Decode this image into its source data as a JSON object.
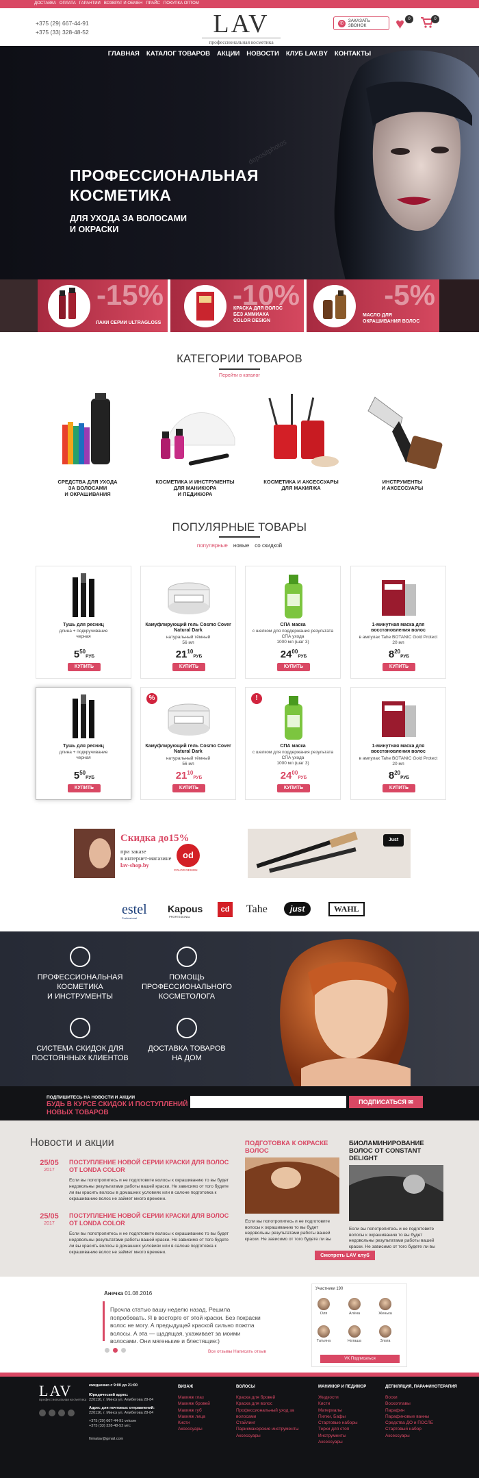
{
  "topbar": {
    "links": [
      "Доставка",
      "Оплата",
      "Гарантии",
      "Возврат и обмен",
      "Прайс",
      "Покупка оптом"
    ]
  },
  "header": {
    "phones": [
      "+375 (29) 667-44-91",
      "+375 (33) 328-48-52"
    ],
    "logo": "LAV",
    "logo_sub": "профессиональная косметика",
    "call_button": "Заказать звонок",
    "favorites_count": "0",
    "cart_count": "0"
  },
  "nav": [
    "Главная",
    "Каталог товаров",
    "Акции",
    "Новости",
    "Клуб LAV.BY",
    "Контакты"
  ],
  "hero": {
    "title_line1": "Профессиональная",
    "title_line2": "косметика",
    "subtitle_line1": "для ухода за волосами",
    "subtitle_line2": "и окраски",
    "watermark": "depositphotos"
  },
  "promo_banners": [
    {
      "discount": "-15%",
      "label": "Лаки серии ULTRAGLOSS",
      "color": "#c8374f"
    },
    {
      "discount": "-10%",
      "label_lines": [
        "Краска для волос",
        "без аммиака",
        "COLOR DESIGN"
      ],
      "color": "#c8374f"
    },
    {
      "discount": "-5%",
      "label_lines": [
        "Масло для",
        "окрашивания волос"
      ],
      "color": "#c8374f"
    }
  ],
  "categories": {
    "title": "Категории товаров",
    "catalog_link": "Перейти в каталог",
    "items": [
      {
        "lines": [
          "Средства для ухода",
          "за волосами",
          "и окрашивания"
        ]
      },
      {
        "lines": [
          "Косметика и инструменты",
          "для маникюра",
          "и педикюра"
        ]
      },
      {
        "lines": [
          "Косметика и аксессуары",
          "для макияжа"
        ]
      },
      {
        "lines": [
          "Инструменты",
          "и аксессуары"
        ]
      }
    ]
  },
  "popular": {
    "title": "Популярные товары",
    "tabs": [
      "популярные",
      "новые",
      "со скидкой"
    ],
    "buy_label": "купить",
    "currency": "руб",
    "products": [
      {
        "name": "Тушь для ресниц",
        "desc": [
          "длина + подкручивание",
          "черная"
        ],
        "rub": "5",
        "kop": "50",
        "mark": ""
      },
      {
        "name": "Камуфлирующий гель Cosmo Cover Natural Dark",
        "desc": [
          "натуральный тёмный",
          "56 мл"
        ],
        "rub": "21",
        "kop": "10",
        "mark": ""
      },
      {
        "name": "СПА маска",
        "desc": [
          "с шелком для поддержания результата",
          "СПА ухода",
          "1000 мл (шаг 3)"
        ],
        "rub": "24",
        "kop": "00",
        "mark": ""
      },
      {
        "name": "1-минутная маска для восстановления волос",
        "desc": [
          "в ампулах Tahe BOTANIC Gold Protect",
          "20 мл"
        ],
        "rub": "8",
        "kop": "20",
        "mark": ""
      },
      {
        "name": "Тушь для ресниц",
        "desc": [
          "длина + подкручивание",
          "черная"
        ],
        "rub": "5",
        "kop": "50",
        "mark": ""
      },
      {
        "name": "Камуфлирующий гель Cosmo Cover Natural Dark",
        "desc": [
          "натуральный тёмный",
          "56 мл"
        ],
        "rub": "21",
        "kop": "10",
        "mark": "%"
      },
      {
        "name": "СПА маска",
        "desc": [
          "с шелком для поддержания результата",
          "СПА ухода",
          "1000 мл (шаг 3)"
        ],
        "rub": "24",
        "kop": "00",
        "mark": "!"
      },
      {
        "name": "1-минутная маска для восстановления волос",
        "desc": [
          "в ампулах Tahe BOTANIC Gold Protect",
          "20 мл"
        ],
        "rub": "8",
        "kop": "20",
        "mark": ""
      }
    ]
  },
  "ad_banner": {
    "title": "Скидка до15%",
    "line1": "при заказе",
    "line2": "в интернет-магазине",
    "site": "lav-shop.by",
    "brand": "od",
    "brand_sub": "COLOR DESIGN",
    "right_brand": "Just"
  },
  "brands": [
    "estel",
    "Kapous",
    "cd",
    "Tahe",
    "just",
    "WAHL"
  ],
  "brands_sub": {
    "estel": "Professional",
    "Kapous": "PROFESSIONAL"
  },
  "features": [
    {
      "lines": [
        "Профессиональная",
        "косметика",
        "и инструменты"
      ]
    },
    {
      "lines": [
        "Помощь",
        "профессионального",
        "косметолога"
      ]
    },
    {
      "lines": [
        "Система скидок для",
        "постоянных клиентов"
      ]
    },
    {
      "lines": [
        "Доставка товаров",
        "на дом"
      ]
    }
  ],
  "subscribe": {
    "small": "Подпишитесь на новости и акции",
    "big_line1": "Будь в курсе скидок и поступлений",
    "big_line2": "новых товаров",
    "button": "Подписаться"
  },
  "news": {
    "title": "Новости и акции",
    "items": [
      {
        "day": "25/05",
        "year": "2017",
        "head": "Поступление новой серии краски для волос от LONDA COLOR",
        "text": "Если вы попотропитесь и не подготовите волосы к окрашиванию то вы будет недовольны результатами работы вашей краски. Не зависимо от того будете ли вы красить волосы в домашних условиях или в салоне подготовка к окрашиванию волос не займет много времени."
      },
      {
        "day": "25/05",
        "year": "2017",
        "head": "Поступление новой серии краски для волос от LONDA COLOR",
        "text": "Если вы попотропитесь и не подготовите волосы к окрашиванию то вы будет недовольны результатами работы вашей краски. Не зависимо от того будете ли вы красить волосы в домашних условиях или в салоне подготовка к окрашиванию волос не займет много времени."
      }
    ],
    "cards": [
      {
        "head": "Подготовка к окраске волос",
        "text": "Если вы попотропитесь и не подготовите волосы к окрашиванию то вы будет недовольны результатами работы вашей краски. Не зависимо от того будете ли вы",
        "color": "#d94864"
      },
      {
        "head": "Биоламинирование волос от CONSTANT DELIGHT",
        "text": "Если вы попотропитесь и не подготовите волосы к окрашиванию то вы будет недовольны результатами работы вашей краски. Не зависимо от того будете ли вы",
        "color": "#222222"
      }
    ],
    "club_button": "Смотреть LAV клуб"
  },
  "review": {
    "author": "Анечка",
    "date": "01.08.2016",
    "text": "Прочла статью вашу неделю назад. Решила попробовать. Я в восторге от этой краски. Без покраски волос не могу. А предыдущей краской сильно пожгла волосы. А эта — щадящая, ухаживает за моими волосами. Они мягенькие и блестящие:)",
    "links": "Все отзывы    Написать отзыв"
  },
  "vk": {
    "header": "Участники  190",
    "members": [
      "Оля",
      "Алёна",
      "Женька",
      "Татьяна",
      "Наташа",
      "Злата"
    ],
    "subscribe": "Подписаться"
  },
  "footer": {
    "logo": "LAV",
    "logo_sub": "профессиональная косметика",
    "hours": "ежедневно с 9:00 до 21:00",
    "address_title": "Юридический адрес:",
    "address": "220116, г. Минск ул. Алибегова 28-84",
    "postal_title": "Адрес для почтовых отправлений:",
    "postal": "220116, г. Минск ул. Алибегова 28-84",
    "phones": [
      "+375 (29) 667-44-91 velcom",
      "+375 (33) 328-48-52 мтс"
    ],
    "email": "firmatav@gmail.com",
    "columns": [
      {
        "title": "Визаж",
        "links": [
          "Макияж глаз",
          "Макияж бровей",
          "Макияж губ",
          "Макияж лица",
          "Кисти",
          "Аксессуары"
        ]
      },
      {
        "title": "Волосы",
        "links": [
          "Краска для бровей",
          "Краска для волос",
          "Профессиональный уход за волосами",
          "Стайлинг",
          "Парикмахерские инструменты",
          "Аксессуары"
        ]
      },
      {
        "title": "Маникюр и педикюр",
        "links": [
          "Жидкости",
          "Кисти",
          "Материалы",
          "Пилки, Бафы",
          "Стартовые наборы",
          "Терки для стоп",
          "Инструменты",
          "Аксессуары"
        ]
      },
      {
        "title": "Депиляция, парафинотерапия",
        "links": [
          "Воски",
          "Воскоплавы",
          "Парафин",
          "Парафиновые ванны",
          "Средства ДО и ПОСЛЕ",
          "Стартовый набор",
          "Аксессуары"
        ]
      }
    ]
  }
}
